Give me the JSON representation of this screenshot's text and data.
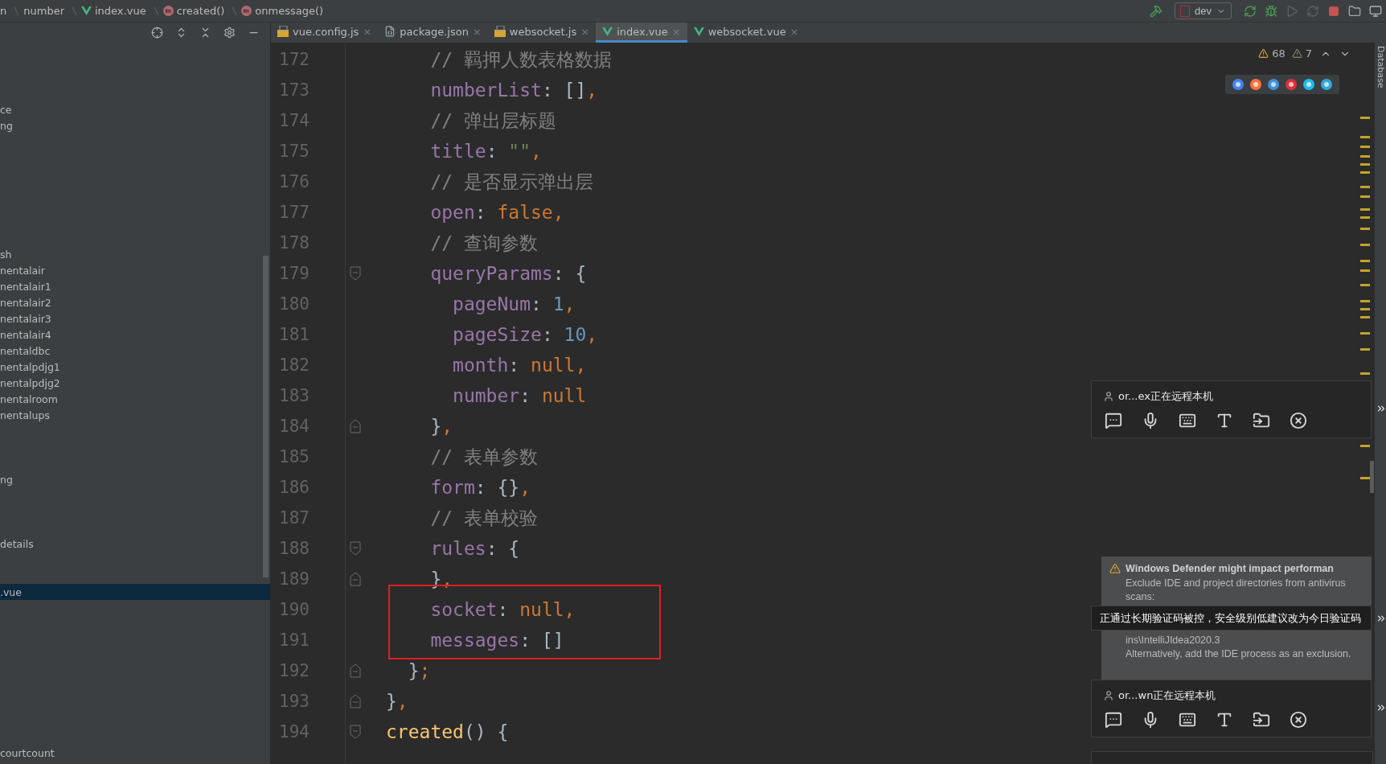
{
  "breadcrumb": [
    {
      "label": "n",
      "kind": "plain"
    },
    {
      "label": "number",
      "kind": "plain"
    },
    {
      "label": "index.vue",
      "kind": "vue"
    },
    {
      "label": "created()",
      "kind": "method"
    },
    {
      "label": "onmessage()",
      "kind": "method"
    }
  ],
  "run_config": {
    "label": "dev"
  },
  "tabs": [
    {
      "label": "vue.config.js",
      "kind": "js",
      "close": "×",
      "selected": false
    },
    {
      "label": "package.json",
      "kind": "json",
      "close": "×",
      "selected": false
    },
    {
      "label": "websocket.js",
      "kind": "js",
      "close": "×",
      "selected": false
    },
    {
      "label": "index.vue",
      "kind": "vue",
      "close": "×",
      "selected": true
    },
    {
      "label": "websocket.vue",
      "kind": "vue",
      "close": "×",
      "selected": false
    }
  ],
  "sidebar": {
    "items": [
      {
        "label": "ce",
        "selected": false
      },
      {
        "label": "ng",
        "selected": false
      },
      {
        "label": "sh",
        "selected": false
      },
      {
        "label": "nentalair",
        "selected": false
      },
      {
        "label": "nentalair1",
        "selected": false
      },
      {
        "label": "nentalair2",
        "selected": false
      },
      {
        "label": "nentalair3",
        "selected": false
      },
      {
        "label": "nentalair4",
        "selected": false
      },
      {
        "label": "nentaldbc",
        "selected": false
      },
      {
        "label": "nentalpdjg1",
        "selected": false
      },
      {
        "label": "nentalpdjg2",
        "selected": false
      },
      {
        "label": "nentalroom",
        "selected": false
      },
      {
        "label": "nentalups",
        "selected": false
      },
      {
        "label": "ng",
        "selected": false
      },
      {
        "label": "details",
        "selected": false
      },
      {
        "label": ".vue",
        "selected": true
      },
      {
        "label": "courtcount",
        "selected": false
      }
    ]
  },
  "inspections": {
    "warnings": "68",
    "weak_warnings": "7"
  },
  "side_tool": "Database",
  "editor": {
    "lines": [
      {
        "number": "172",
        "tokens": [
          {
            "kind": "comment",
            "text": "    // 羁押人数表格数据"
          }
        ]
      },
      {
        "number": "173",
        "tokens": [
          {
            "kind": "key",
            "text": "    numberList"
          },
          {
            "kind": "punct",
            "text": ": []"
          },
          {
            "kind": "comma",
            "text": ","
          }
        ]
      },
      {
        "number": "174",
        "tokens": [
          {
            "kind": "comment",
            "text": "    // 弹出层标题"
          }
        ]
      },
      {
        "number": "175",
        "tokens": [
          {
            "kind": "key",
            "text": "    title"
          },
          {
            "kind": "punct",
            "text": ": "
          },
          {
            "kind": "string",
            "text": "\"\""
          },
          {
            "kind": "comma",
            "text": ","
          }
        ]
      },
      {
        "number": "176",
        "tokens": [
          {
            "kind": "comment",
            "text": "    // 是否显示弹出层"
          }
        ]
      },
      {
        "number": "177",
        "tokens": [
          {
            "kind": "key",
            "text": "    open"
          },
          {
            "kind": "punct",
            "text": ": "
          },
          {
            "kind": "keyword",
            "text": "false"
          },
          {
            "kind": "comma",
            "text": ","
          }
        ]
      },
      {
        "number": "178",
        "tokens": [
          {
            "kind": "comment",
            "text": "    // 查询参数"
          }
        ]
      },
      {
        "number": "179",
        "fold_end": false,
        "tokens": [
          {
            "kind": "key",
            "text": "    queryParams"
          },
          {
            "kind": "punct",
            "text": ": {"
          }
        ]
      },
      {
        "number": "180",
        "tokens": [
          {
            "kind": "key",
            "text": "      pageNum"
          },
          {
            "kind": "punct",
            "text": ": "
          },
          {
            "kind": "number",
            "text": "1"
          },
          {
            "kind": "comma",
            "text": ","
          }
        ]
      },
      {
        "number": "181",
        "tokens": [
          {
            "kind": "key",
            "text": "      pageSize"
          },
          {
            "kind": "punct",
            "text": ": "
          },
          {
            "kind": "number",
            "text": "10"
          },
          {
            "kind": "comma",
            "text": ","
          }
        ]
      },
      {
        "number": "182",
        "tokens": [
          {
            "kind": "key",
            "text": "      month"
          },
          {
            "kind": "punct",
            "text": ": "
          },
          {
            "kind": "keyword",
            "text": "null"
          },
          {
            "kind": "comma",
            "text": ","
          }
        ]
      },
      {
        "number": "183",
        "tokens": [
          {
            "kind": "key",
            "text": "      number"
          },
          {
            "kind": "punct",
            "text": ": "
          },
          {
            "kind": "keyword",
            "text": "null"
          }
        ]
      },
      {
        "number": "184",
        "fold_end": true,
        "tokens": [
          {
            "kind": "punct",
            "text": "    }"
          },
          {
            "kind": "comma",
            "text": ","
          }
        ]
      },
      {
        "number": "185",
        "tokens": [
          {
            "kind": "comment",
            "text": "    // 表单参数"
          }
        ]
      },
      {
        "number": "186",
        "tokens": [
          {
            "kind": "key",
            "text": "    form"
          },
          {
            "kind": "punct",
            "text": ": {}"
          },
          {
            "kind": "comma",
            "text": ","
          }
        ]
      },
      {
        "number": "187",
        "tokens": [
          {
            "kind": "comment",
            "text": "    // 表单校验"
          }
        ]
      },
      {
        "number": "188",
        "fold_end": false,
        "tokens": [
          {
            "kind": "key",
            "text": "    rules"
          },
          {
            "kind": "punct",
            "text": ": {"
          }
        ]
      },
      {
        "number": "189",
        "fold_end": true,
        "tokens": [
          {
            "kind": "punct",
            "text": "    }"
          },
          {
            "kind": "comma",
            "text": ","
          }
        ]
      },
      {
        "number": "190",
        "tokens": [
          {
            "kind": "key",
            "text": "    socket"
          },
          {
            "kind": "punct",
            "text": ": "
          },
          {
            "kind": "keyword",
            "text": "null"
          },
          {
            "kind": "comma",
            "text": ","
          }
        ]
      },
      {
        "number": "191",
        "tokens": [
          {
            "kind": "key",
            "text": "    messages"
          },
          {
            "kind": "punct",
            "text": ": []"
          }
        ]
      },
      {
        "number": "192",
        "fold_end": true,
        "tokens": [
          {
            "kind": "punct",
            "text": "  }"
          },
          {
            "kind": "comma",
            "text": ";"
          }
        ]
      },
      {
        "number": "193",
        "fold_end": true,
        "tokens": [
          {
            "kind": "punct",
            "text": "}"
          },
          {
            "kind": "comma",
            "text": ","
          }
        ]
      },
      {
        "number": "194",
        "fold_end": false,
        "tokens": [
          {
            "kind": "function",
            "text": "created"
          },
          {
            "kind": "punct",
            "text": "() {"
          }
        ]
      }
    ]
  },
  "sessions": [
    {
      "title": "or...ex正在远程本机"
    },
    {
      "title": "or...wn正在远程本机"
    }
  ],
  "notification": {
    "title": "Windows Defender might impact performan",
    "paragraphs": [
      "Exclude IDE and project directories from antivirus scans:",
      "ins\\IntelliJIdea2020.3",
      "Alternatively, add the IDE process as an exclusion."
    ]
  },
  "tooltip": {
    "text": "正通过长期验证码被控，安全级别低建议改为今日验证码"
  }
}
